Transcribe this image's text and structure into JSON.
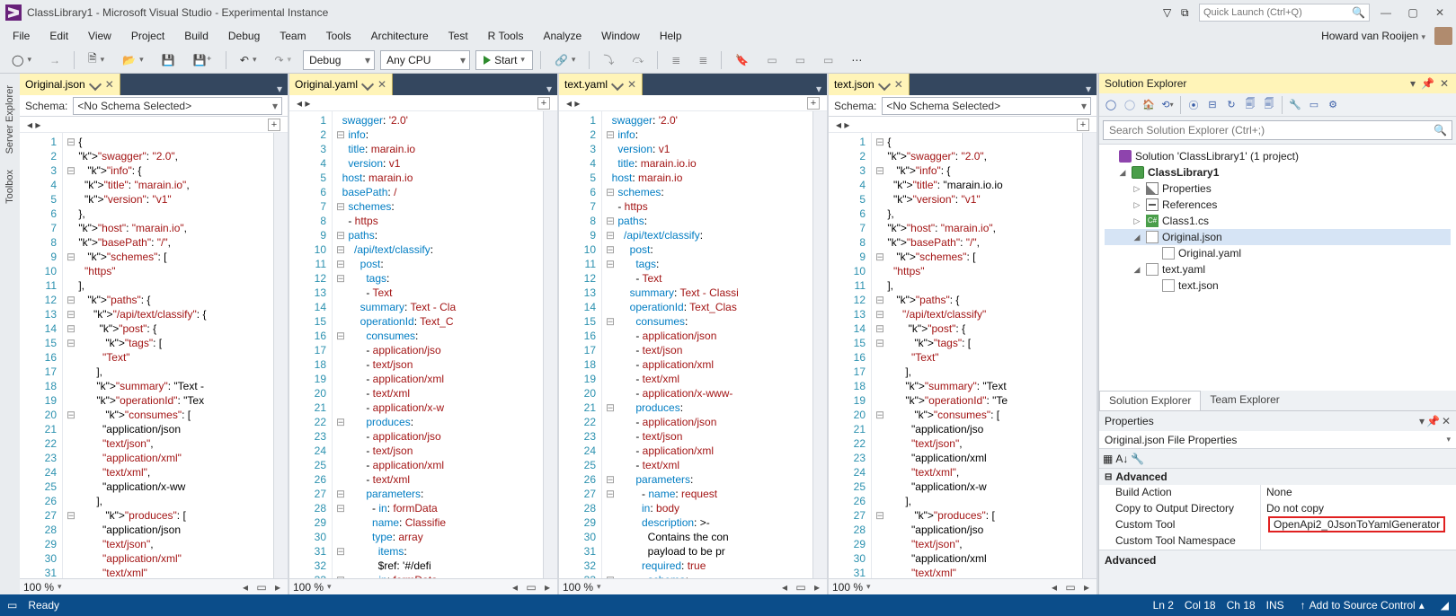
{
  "title": "ClassLibrary1 - Microsoft Visual Studio  - Experimental Instance",
  "quick_launch_placeholder": "Quick Launch (Ctrl+Q)",
  "menu": [
    "File",
    "Edit",
    "View",
    "Project",
    "Build",
    "Debug",
    "Team",
    "Tools",
    "Architecture",
    "Test",
    "R Tools",
    "Analyze",
    "Window",
    "Help"
  ],
  "user_name": "Howard van Rooijen",
  "toolbar": {
    "config": "Debug",
    "platform": "Any CPU",
    "start": "Start"
  },
  "side_tabs": [
    "Server Explorer",
    "Toolbox"
  ],
  "schema_label": "Schema:",
  "schema_value": "<No Schema Selected>",
  "editors": [
    {
      "tab": "Original.json",
      "has_schema": true,
      "lines": [
        "⊟{",
        "    \"swagger\": \"2.0\",",
        "⊟   \"info\": {",
        "      \"title\": \"marain.io\",",
        "      \"version\": \"v1\"",
        "    },",
        "    \"host\": \"marain.io\",",
        "    \"basePath\": \"/\",",
        "⊟   \"schemes\": [",
        "      \"https\"",
        "    ],",
        "⊟   \"paths\": {",
        "⊟     \"/api/text/classify\": {",
        "⊟       \"post\": {",
        "⊟         \"tags\": [",
        "            \"Text\"",
        "          ],",
        "          \"summary\": \"Text - ",
        "          \"operationId\": \"Tex",
        "⊟         \"consumes\": [",
        "            \"application/json",
        "            \"text/json\",",
        "            \"application/xml\"",
        "            \"text/xml\",",
        "            \"application/x-ww",
        "          ],",
        "⊟         \"produces\": [",
        "            \"application/json",
        "            \"text/json\",",
        "            \"application/xml\"",
        "            \"text/xml\""
      ]
    },
    {
      "tab": "Original.yaml",
      "has_schema": false,
      "lines": [
        "  swagger: '2.0'",
        "⊟info:",
        "    title: marain.io",
        "    version: v1",
        "  host: marain.io",
        "  basePath: /",
        "⊟schemes:",
        "    - https",
        "⊟paths:",
        "⊟  /api/text/classify:",
        "⊟    post:",
        "⊟      tags:",
        "          - Text",
        "        summary: Text - Cla",
        "        operationId: Text_C",
        "⊟      consumes:",
        "          - application/jso",
        "          - text/json",
        "          - application/xml",
        "          - text/xml",
        "          - application/x-w",
        "⊟      produces:",
        "          - application/jso",
        "          - text/json",
        "          - application/xml",
        "          - text/xml",
        "⊟      parameters:",
        "⊟        - in: formData",
        "            name: Classifie",
        "            type: array",
        "⊟          items:",
        "              $ref: '#/defi",
        "⊟        - in: formData"
      ]
    },
    {
      "tab": "text.yaml",
      "has_schema": false,
      "lines": [
        "  swagger: '2.0'",
        "⊟info:",
        "    version: v1",
        "    title: marain.io.io",
        "  host: marain.io",
        "⊟schemes:",
        "    - https",
        "⊟paths:",
        "⊟  /api/text/classify:",
        "⊟    post:",
        "⊟      tags:",
        "          - Text",
        "        summary: Text - Classi",
        "        operationId: Text_Clas",
        "⊟      consumes:",
        "          - application/json",
        "          - text/json",
        "          - application/xml",
        "          - text/xml",
        "          - application/x-www-",
        "⊟      produces:",
        "          - application/json",
        "          - text/json",
        "          - application/xml",
        "          - text/xml",
        "⊟      parameters:",
        "⊟        - name: request",
        "            in: body",
        "            description: >-",
        "              Contains the con",
        "              payload to be pr",
        "            required: true",
        "⊟          schema:"
      ]
    },
    {
      "tab": "text.json",
      "has_schema": true,
      "lines": [
        "⊟{",
        "    \"swagger\": \"2.0\",",
        "⊟   \"info\": {",
        "      \"title\": \"marain.io.io",
        "      \"version\": \"v1\"",
        "    },",
        "    \"host\": \"marain.io\",",
        "    \"basePath\": \"/\",",
        "⊟   \"schemes\": [",
        "      \"https\"",
        "    ],",
        "⊟   \"paths\": {",
        "⊟     \"/api/text/classify\"",
        "⊟       \"post\": {",
        "⊟         \"tags\": [",
        "            \"Text\"",
        "          ],",
        "          \"summary\": \"Text",
        "          \"operationId\": \"Te",
        "⊟         \"consumes\": [",
        "            \"application/jso",
        "            \"text/json\",",
        "            \"application/xml",
        "            \"text/xml\",",
        "            \"application/x-w",
        "          ],",
        "⊟         \"produces\": [",
        "            \"application/jso",
        "            \"text/json\",",
        "            \"application/xml",
        "            \"text/xml\""
      ]
    }
  ],
  "zoom": "100 %",
  "solution_explorer": {
    "title": "Solution Explorer",
    "search_placeholder": "Search Solution Explorer (Ctrl+;)",
    "solution": "Solution 'ClassLibrary1' (1 project)",
    "project": "ClassLibrary1",
    "nodes": [
      "Properties",
      "References",
      "Class1.cs"
    ],
    "original_json": "Original.json",
    "original_yaml": "Original.yaml",
    "text_yaml": "text.yaml",
    "text_json": "text.json",
    "tab2": "Team Explorer"
  },
  "properties": {
    "title": "Properties",
    "header": "Original.json File Properties",
    "category": "Advanced",
    "rows": [
      {
        "name": "Build Action",
        "val": "None"
      },
      {
        "name": "Copy to Output Directory",
        "val": "Do not copy"
      },
      {
        "name": "Custom Tool",
        "val": "OpenApi2_0JsonToYamlGenerator",
        "hl": true
      },
      {
        "name": "Custom Tool Namespace",
        "val": ""
      }
    ],
    "desc": "Advanced"
  },
  "status": {
    "ready": "Ready",
    "ln": "Ln 2",
    "col": "Col 18",
    "ch": "Ch 18",
    "ins": "INS",
    "src": "Add to Source Control"
  }
}
